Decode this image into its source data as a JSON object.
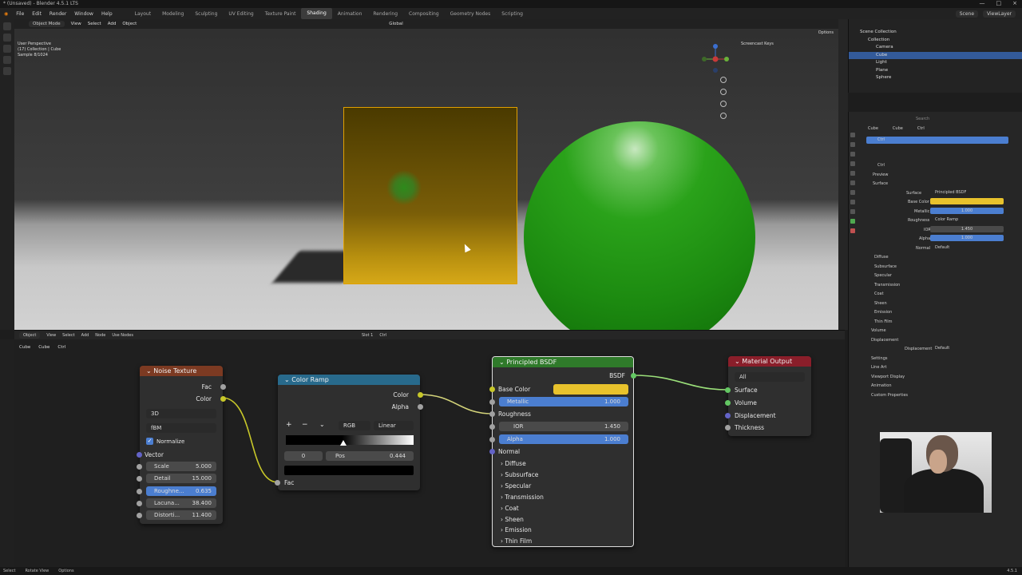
{
  "window": {
    "title": "* (Unsaved) - Blender 4.5.1 LTS",
    "controls": [
      "—",
      "□",
      "×"
    ]
  },
  "menu": [
    "File",
    "Edit",
    "Render",
    "Window",
    "Help"
  ],
  "workspaces": [
    "Layout",
    "Modeling",
    "Sculpting",
    "UV Editing",
    "Texture Paint",
    "Shading",
    "Animation",
    "Rendering",
    "Compositing",
    "Geometry Nodes",
    "Scripting"
  ],
  "active_workspace": "Shading",
  "topright": {
    "scene": "Scene",
    "view_layer": "ViewLayer"
  },
  "viewport": {
    "mode": "Object Mode",
    "menus": [
      "View",
      "Select",
      "Add",
      "Object"
    ],
    "orientation": "Global",
    "info_lines": [
      "User Perspective",
      "(17) Collection | Cube",
      "Sample 8/1024"
    ],
    "screencast": "Screencast Keys",
    "options": "Options"
  },
  "outliner": {
    "header": "Scene Collection",
    "items": [
      {
        "label": "Collection",
        "selected": false
      },
      {
        "label": "Camera",
        "selected": false
      },
      {
        "label": "Cube",
        "selected": true
      },
      {
        "label": "Light",
        "selected": false
      },
      {
        "label": "Plane",
        "selected": false
      },
      {
        "label": "Sphere",
        "selected": false
      }
    ]
  },
  "properties": {
    "search_placeholder": "Search",
    "breadcrumb": [
      "Cube",
      "Cube",
      "Ctrl"
    ],
    "material_slot": "Ctrl",
    "material_name": "Ctrl",
    "sections": {
      "preview": "Preview",
      "surface": "Surface",
      "surface_value": "Principled BSDF",
      "base_color": "Base Color",
      "metallic": "Metallic",
      "metallic_value": "1.000",
      "roughness": "Roughness",
      "roughness_value": "Color Ramp",
      "ior": "IOR",
      "ior_value": "1.450",
      "alpha": "Alpha",
      "alpha_value": "1.000",
      "normal": "Normal",
      "normal_value": "Default",
      "collapsed": [
        "Diffuse",
        "Subsurface",
        "Specular",
        "Transmission",
        "Coat",
        "Sheen",
        "Emission",
        "Thin Film"
      ],
      "volume": "Volume",
      "displacement": "Displacement",
      "displacement_label": "Displacement",
      "displacement_value": "Default",
      "others": [
        "Settings",
        "Line Art",
        "Viewport Display",
        "Animation",
        "Custom Properties"
      ]
    },
    "base_color_hex": "#e8c22c"
  },
  "node_editor": {
    "header": {
      "type": "Object",
      "menus": [
        "View",
        "Select",
        "Add",
        "Node"
      ],
      "use_nodes": "Use Nodes",
      "slot": "Slot 1",
      "material": "Ctrl"
    },
    "breadcrumb": [
      "Cube",
      "Cube",
      "Ctrl"
    ],
    "nodes": {
      "noise": {
        "title": "Noise Texture",
        "out_fac": "Fac",
        "out_color": "Color",
        "dim": "3D",
        "type": "fBM",
        "normalize": "Normalize",
        "vector": "Vector",
        "fields": [
          {
            "label": "Scale",
            "value": "5.000"
          },
          {
            "label": "Detail",
            "value": "15.000"
          },
          {
            "label": "Roughne...",
            "value": "0.635"
          },
          {
            "label": "Lacuna...",
            "value": "38.400"
          },
          {
            "label": "Distorti...",
            "value": "11.400"
          }
        ]
      },
      "ramp": {
        "title": "Color Ramp",
        "out_color": "Color",
        "out_alpha": "Alpha",
        "mode": "RGB",
        "interp": "Linear",
        "index": "0",
        "pos_label": "Pos",
        "pos_value": "0.444",
        "in_fac": "Fac"
      },
      "bsdf": {
        "title": "Principled BSDF",
        "out": "BSDF",
        "base_color": "Base Color",
        "metallic": "Metallic",
        "metallic_value": "1.000",
        "roughness": "Roughness",
        "ior": "IOR",
        "ior_value": "1.450",
        "alpha": "Alpha",
        "alpha_value": "1.000",
        "normal": "Normal",
        "panels": [
          "Diffuse",
          "Subsurface",
          "Specular",
          "Transmission",
          "Coat",
          "Sheen",
          "Emission",
          "Thin Film"
        ]
      },
      "output": {
        "title": "Material Output",
        "target": "All",
        "inputs": [
          "Surface",
          "Volume",
          "Displacement",
          "Thickness"
        ]
      }
    }
  },
  "statusbar": [
    "Select",
    "Rotate View",
    "Options"
  ],
  "version": "4.5.1",
  "colors": {
    "accent": "#4b7ed0",
    "selection": "#335a9a",
    "noise_header": "#7c3a22",
    "ramp_header": "#286a8c",
    "bsdf_header": "#2f7a2a",
    "output_header": "#8a1e2a",
    "yellow_socket": "#c7c729",
    "wire": "#d4d47a"
  }
}
